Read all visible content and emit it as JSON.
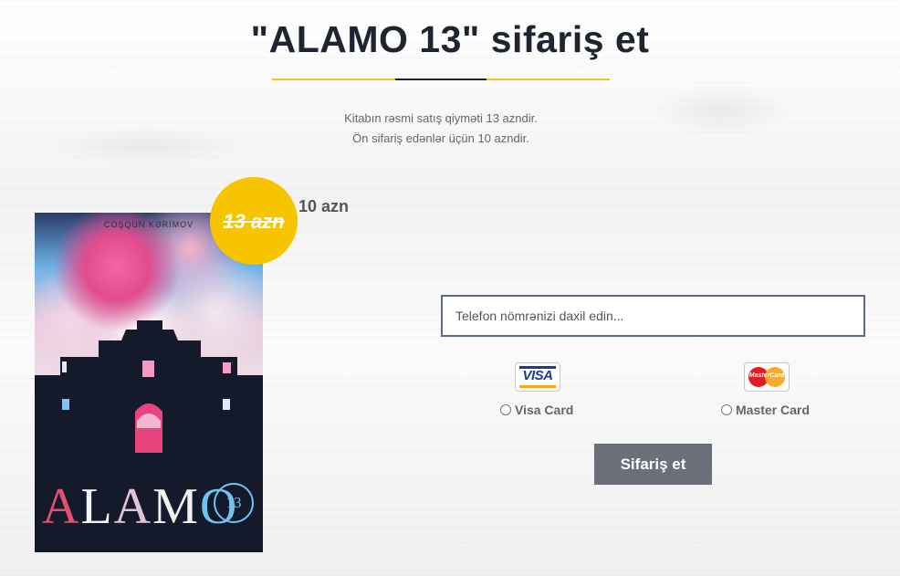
{
  "header": {
    "title": "\"ALAMO 13\" sifariş et",
    "subtitle_line1": "Kitabın rəsmi satış qiyməti 13 azndir.",
    "subtitle_line2": "Ön sifariş edənlər üçün 10 azndir."
  },
  "book": {
    "author": "COŞQUN KƏRİMOV",
    "cover_title": "ALAMO",
    "cover_number": "13",
    "old_price": "13 azn",
    "new_price": "10 azn"
  },
  "form": {
    "phone_placeholder": "Telefon nömrənizi daxil edin...",
    "phone_value": "",
    "payment_options": [
      {
        "label": "Visa Card",
        "logo_text": "VISA",
        "icon": "visa-logo-icon",
        "selected": false
      },
      {
        "label": "Master Card",
        "logo_text": "MasterCard",
        "icon": "mastercard-logo-icon",
        "selected": false
      }
    ],
    "submit_label": "Sifariş et"
  },
  "colors": {
    "accent_yellow": "#f2c318",
    "badge_yellow": "#f7c500",
    "title_dark": "#1e2430",
    "button_gray": "#6b6f79",
    "input_border": "#5c6b88"
  }
}
